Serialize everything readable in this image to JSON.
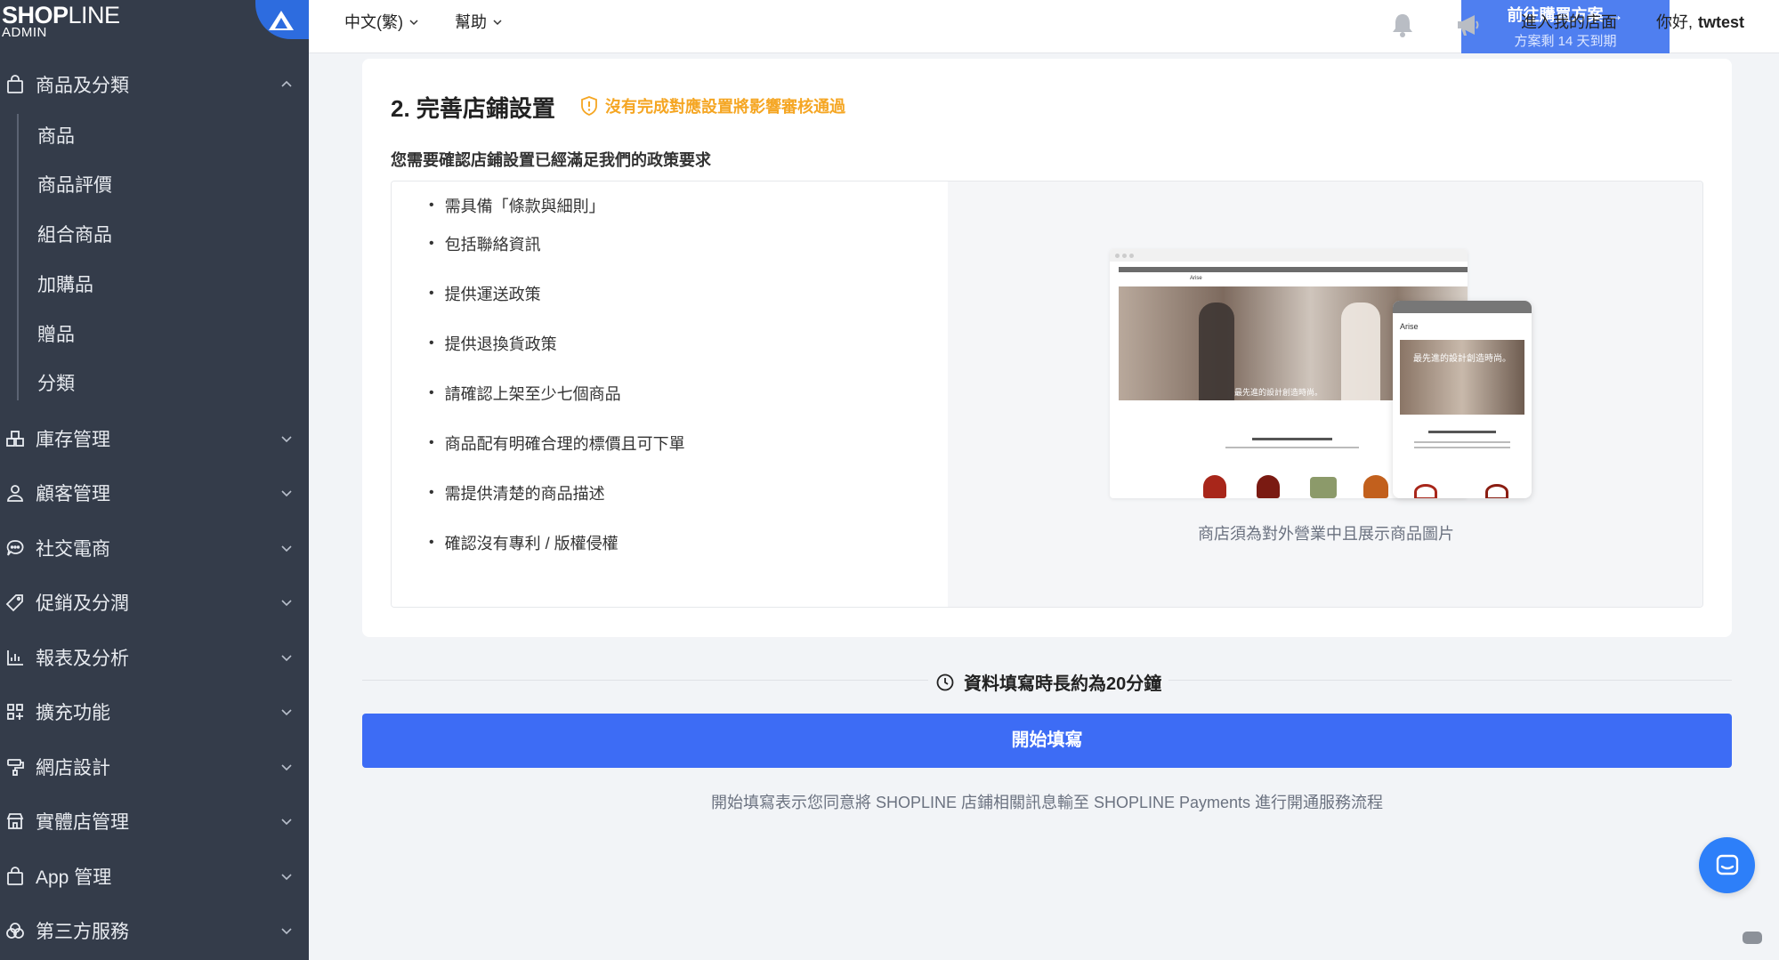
{
  "brand": {
    "logo_bold": "SHOP",
    "logo_light": "LINE",
    "logo_sub": "ADMIN"
  },
  "sidebar": {
    "groups": [
      {
        "label": "商品及分類",
        "icon": "bag-icon",
        "expanded": true
      },
      {
        "label": "庫存管理",
        "icon": "inventory-icon"
      },
      {
        "label": "顧客管理",
        "icon": "user-icon"
      },
      {
        "label": "社交電商",
        "icon": "chat-icon"
      },
      {
        "label": "促銷及分潤",
        "icon": "tag-icon"
      },
      {
        "label": "報表及分析",
        "icon": "chart-icon"
      },
      {
        "label": "擴充功能",
        "icon": "grid-plus-icon"
      },
      {
        "label": "網店設計",
        "icon": "paint-roller-icon"
      },
      {
        "label": "實體店管理",
        "icon": "store-icon"
      },
      {
        "label": "App 管理",
        "icon": "bag-icon"
      },
      {
        "label": "第三方服務",
        "icon": "circles-icon"
      }
    ],
    "sub_items": [
      "商品",
      "商品評價",
      "組合商品",
      "加購品",
      "贈品",
      "分類"
    ]
  },
  "topbar": {
    "language": "中文(繁)",
    "help": "幫助",
    "buy_title": "前往購買方案 →",
    "buy_sub": "方案剩 14 天到期",
    "store_link": "進入我的店面",
    "greeting": "你好,",
    "username": "twtest"
  },
  "card": {
    "title": "2. 完善店鋪設置",
    "warning": "沒有完成對應設置將影響審核通過",
    "description": "您需要確認店鋪設置已經滿足我們的政策要求",
    "requirements": [
      "需具備「條款與細則」",
      "包括聯絡資訊",
      "提供運送政策",
      "提供退換貨政策",
      "請確認上架至少七個商品",
      "商品配有明確合理的標價且可下單",
      "需提供清楚的商品描述",
      "確認沒有專利 / 版權侵權"
    ],
    "caption": "商店須為對外營業中且展示商品圖片",
    "mock": {
      "brand": "Arise",
      "hero_text": "最先進的設計創造時尚。",
      "mobile_hero": "最先進的設計創造時尚。"
    }
  },
  "footer": {
    "duration": "資料填寫時長約為20分鐘",
    "start_button": "開始填寫",
    "agreement": "開始填寫表示您同意將 SHOPLINE 店鋪相關訊息輸至 SHOPLINE Payments 進行開通服務流程"
  },
  "colors": {
    "sidebar": "#343c4a",
    "primary": "#3d6cf5",
    "warning": "#f5a623",
    "buy": "#4f7ff0"
  }
}
